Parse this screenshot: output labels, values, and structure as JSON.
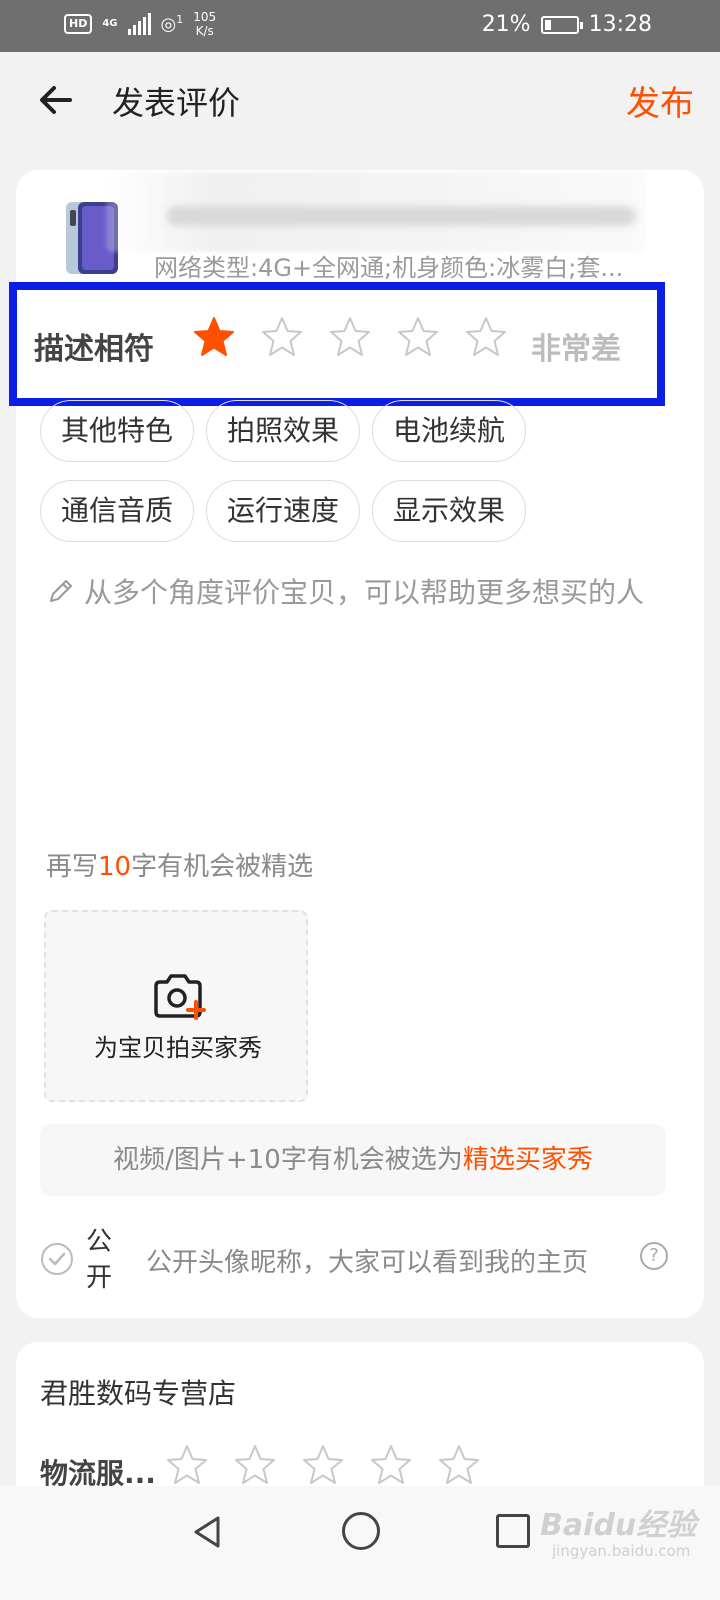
{
  "status_bar": {
    "hd": "HD",
    "network": "4G",
    "wifi_badge": "1",
    "speed_value": "105",
    "speed_unit": "K/s",
    "battery": "21%",
    "battery_level": 0.21,
    "time": "13:28"
  },
  "header": {
    "title": "发表评价",
    "publish": "发布"
  },
  "product": {
    "specs": "网络类型:4G+全网通;机身颜色:冰雾白;套..."
  },
  "rating": {
    "label": "描述相符",
    "score": 1,
    "max": 5,
    "text": "非常差"
  },
  "tags": [
    "其他特色",
    "拍照效果",
    "电池续航",
    "通信音质",
    "运行速度",
    "显示效果"
  ],
  "comment": {
    "placeholder": "从多个角度评价宝贝，可以帮助更多想买的人"
  },
  "hint": {
    "prefix": "再写",
    "number": "10",
    "suffix": "字有机会被精选"
  },
  "photo": {
    "label": "为宝贝拍买家秀"
  },
  "promo": {
    "text": "视频/图片+10字有机会被选为",
    "highlight": "精选买家秀"
  },
  "public": {
    "label": "公开",
    "description": "公开头像昵称，大家可以看到我的主页",
    "help": "?"
  },
  "shop": {
    "name": "君胜数码专营店",
    "logistics_label": "物流服...",
    "logistics_score": 0
  },
  "watermark": {
    "brand": "Baidu经验",
    "url": "jingyan.baidu.com"
  },
  "colors": {
    "accent": "#ff5000",
    "highlight_border": "#0a1ee6"
  }
}
